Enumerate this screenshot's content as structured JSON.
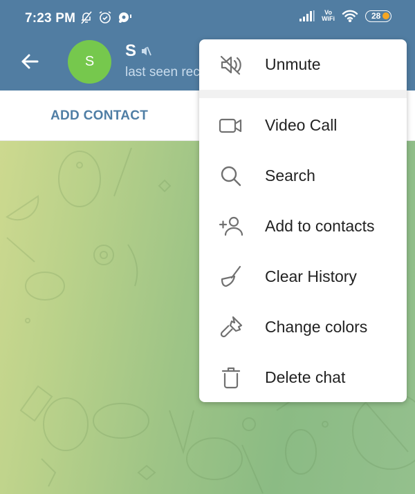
{
  "status_bar": {
    "time": "7:23 PM",
    "left_icons": [
      "bell-off-icon",
      "alarm-icon",
      "chat-bubble-icon"
    ],
    "vowifi_top": "Vo",
    "vowifi_bottom": "WiFi",
    "battery": "28",
    "battery_color": "#f5a623"
  },
  "header": {
    "avatar_letter": "S",
    "avatar_color": "#76c84d",
    "name": "S",
    "status": "last seen recently",
    "bar_color": "#517da2"
  },
  "action_bar": {
    "add_contact": "ADD CONTACT"
  },
  "menu": {
    "items": [
      {
        "icon": "unmute-icon",
        "label": "Unmute"
      },
      {
        "icon": "video-call-icon",
        "label": "Video Call"
      },
      {
        "icon": "search-icon",
        "label": "Search"
      },
      {
        "icon": "add-contact-icon",
        "label": "Add to contacts"
      },
      {
        "icon": "clear-history-icon",
        "label": "Clear History"
      },
      {
        "icon": "paint-brush-icon",
        "label": "Change colors"
      },
      {
        "icon": "trash-icon",
        "label": "Delete chat"
      }
    ]
  }
}
